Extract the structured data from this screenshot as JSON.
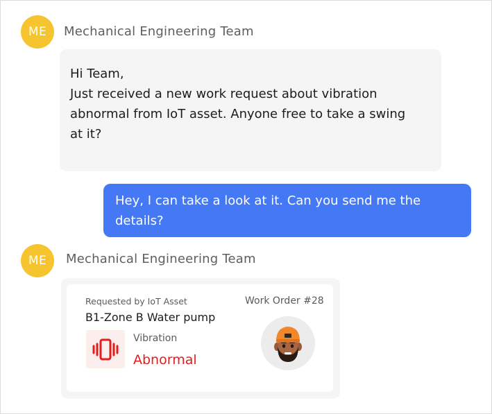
{
  "messages": {
    "first": {
      "avatar_initials": "ME",
      "sender": "Mechanical Engineering Team",
      "lines": [
        "Hi  Team,",
        "Just received a new work request about vibration",
        "abnormal from IoT asset. Anyone free to take a swing",
        "at it?"
      ]
    },
    "reply": {
      "lines": [
        "Hey, I can take a look at it. Can you send me the",
        "details?"
      ]
    },
    "second": {
      "avatar_initials": "ME",
      "sender": "Mechanical Engineering Team"
    }
  },
  "work_order_card": {
    "requested_by_label": "Requested by IoT Asset",
    "asset_name": "B1-Zone B Water pump",
    "work_order": "Work Order #28",
    "metric_label": "Vibration",
    "metric_status": "Abnormal",
    "metric_icon": "vibration-phone-icon",
    "assignee_avatar": "memoji-avatar-orange-cap"
  },
  "colors": {
    "avatar_bg": "#f6c42f",
    "outgoing_bubble": "#4478f5",
    "incoming_bubble": "#f5f5f5",
    "alert_red": "#e01e1e"
  }
}
